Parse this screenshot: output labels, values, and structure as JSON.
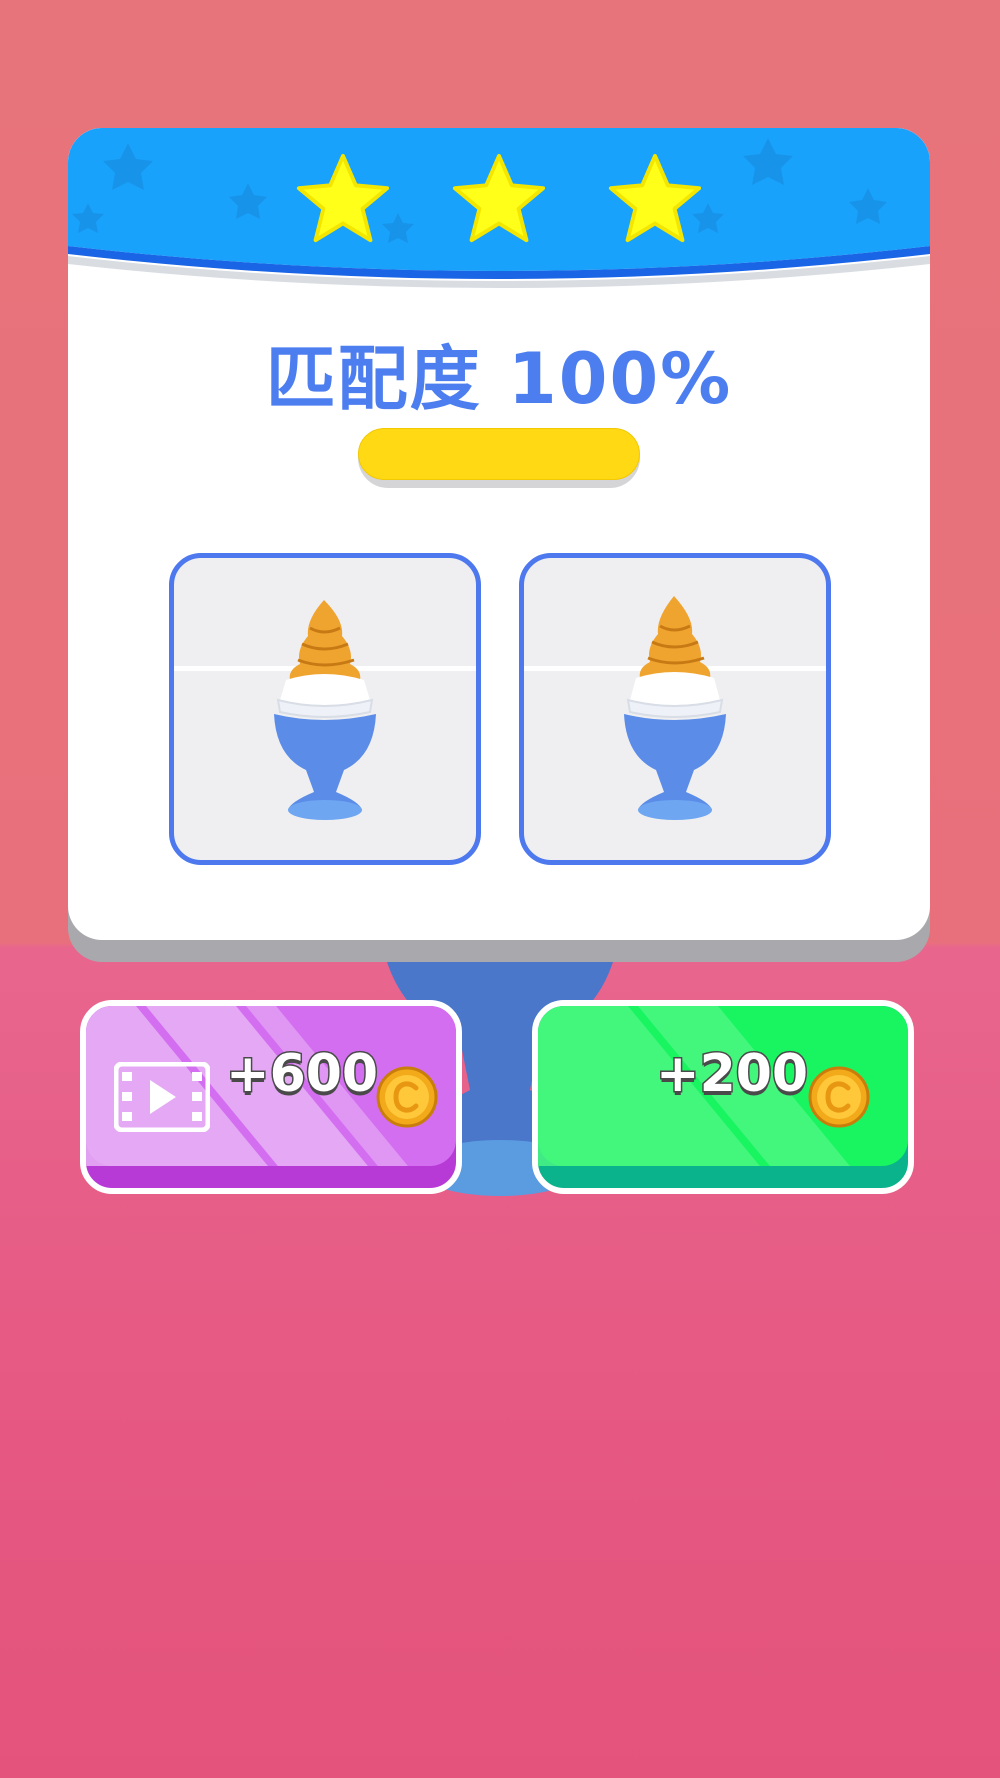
{
  "result": {
    "stars_earned": 3,
    "stars_total": 3,
    "match_label": "匹配度 100%",
    "match_progress": 1.0
  },
  "previews": {
    "target": "target-dessert",
    "player": "player-dessert"
  },
  "buttons": {
    "video_reward": {
      "label": "+600",
      "icon": "video-icon",
      "coin_icon": "coin-icon"
    },
    "normal_reward": {
      "label": "+200",
      "coin_icon": "coin-icon"
    }
  },
  "colors": {
    "header_blue": "#19a2fb",
    "accent_blue": "#4d7ef0",
    "star_yellow": "#ffff1a",
    "progress_yellow": "#ffd914",
    "purple_button": "#d46ef0",
    "green_button": "#18f560"
  }
}
